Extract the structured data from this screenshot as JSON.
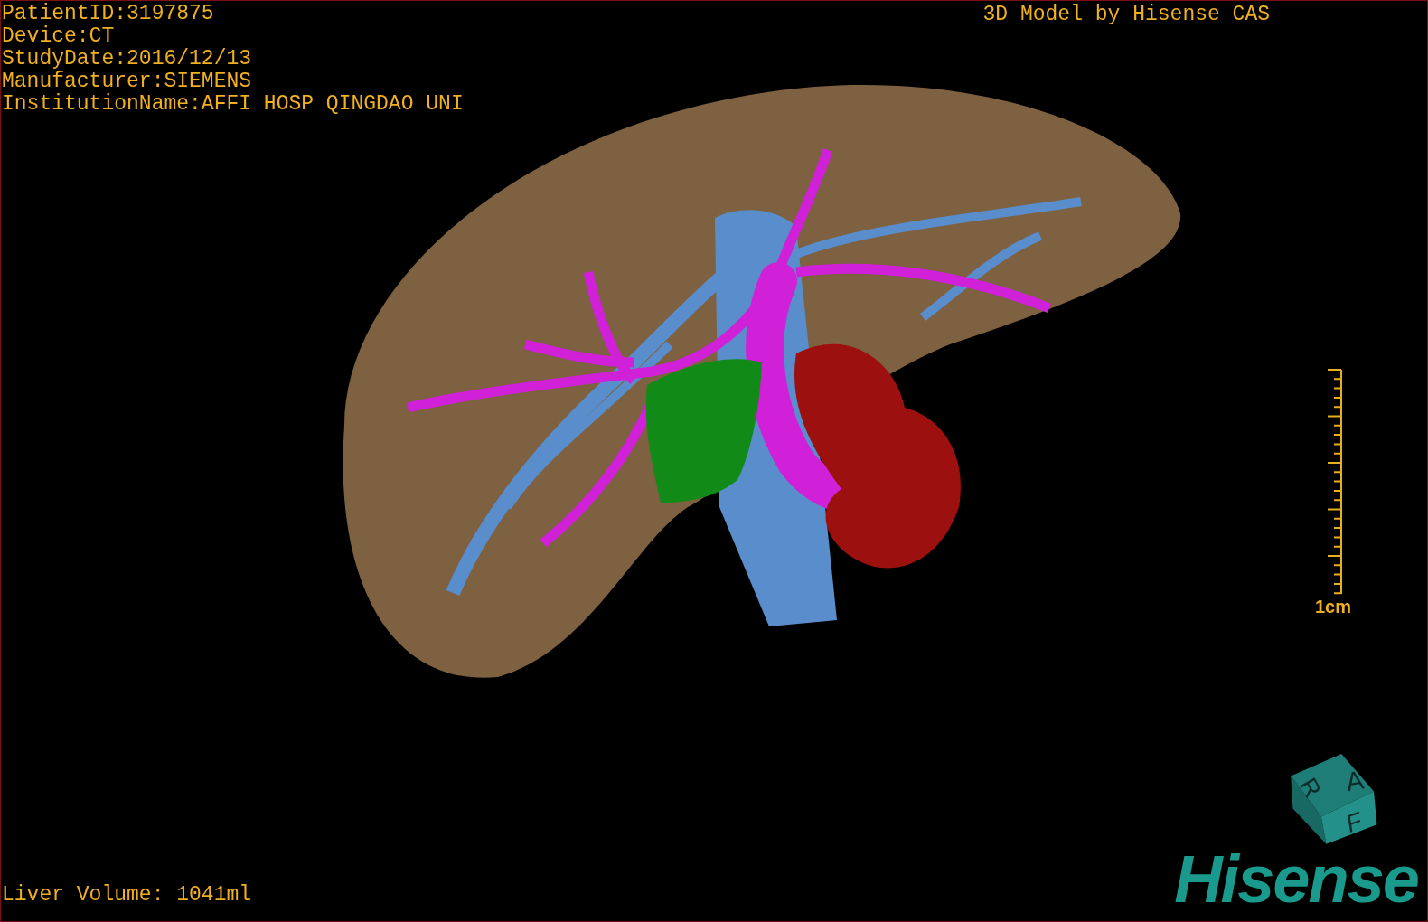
{
  "info_lines": [
    "PatientID:3197875",
    "Device:CT",
    "StudyDate:2016/12/13",
    "Manufacturer:SIEMENS",
    "InstitutionName:AFFI HOSP QINGDAO UNI"
  ],
  "title": "3D Model by Hisense CAS",
  "scale": {
    "label": "1cm"
  },
  "cube": {
    "faces": [
      "A",
      "F",
      "R"
    ]
  },
  "logo": "Hisense",
  "volume": "Liver Volume: 1041ml"
}
